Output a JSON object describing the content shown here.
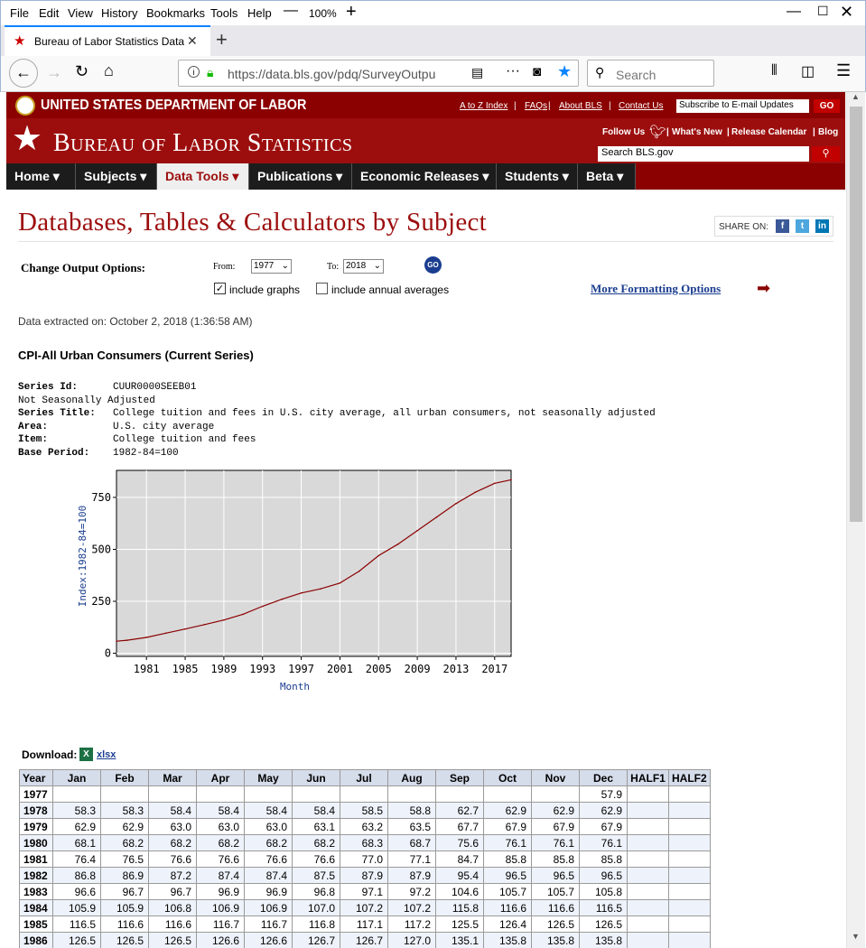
{
  "browser": {
    "menu": [
      "File",
      "Edit",
      "View",
      "History",
      "Bookmarks",
      "Tools",
      "Help"
    ],
    "zoom": "100%",
    "tab_title": "Bureau of Labor Statistics Data",
    "url": "https://data.bls.gov/pdq/SurveyOutpu",
    "search_placeholder": "Search"
  },
  "site": {
    "dept": "UNITED STATES DEPARTMENT OF LABOR",
    "top_links": [
      "A to Z Index",
      "FAQs",
      "About BLS",
      "Contact Us"
    ],
    "subscribe_value": "Subscribe to E-mail Updates",
    "go": "GO",
    "title": "Bureau of Labor Statistics",
    "follow": "Follow Us",
    "header_links": [
      "What's New",
      "Release Calendar",
      "Blog"
    ],
    "search_value": "Search BLS.gov",
    "nav": [
      {
        "label": "Home"
      },
      {
        "label": "Subjects"
      },
      {
        "label": "Data Tools"
      },
      {
        "label": "Publications"
      },
      {
        "label": "Economic Releases"
      },
      {
        "label": "Students"
      },
      {
        "label": "Beta"
      }
    ]
  },
  "page": {
    "heading": "Databases, Tables & Calculators by Subject",
    "share_on": "SHARE ON:",
    "change_output": "Change Output Options:",
    "from_label": "From:",
    "from_value": "1977",
    "to_label": "To:",
    "to_value": "2018",
    "go": "GO",
    "include_graphs": "include graphs",
    "include_annual": "include annual averages",
    "more_formatting": "More Formatting Options",
    "extracted": "Data extracted on: October 2, 2018 (1:36:58 AM)",
    "series_heading": "CPI-All Urban Consumers (Current Series)",
    "series": {
      "id_label": "Series Id:",
      "id": "CUUR0000SEEB01",
      "adj": "Not Seasonally Adjusted",
      "title_label": "Series Title:",
      "title": "College tuition and fees in U.S. city average, all urban consumers, not seasonally adjusted",
      "area_label": "Area:",
      "area": "U.S. city average",
      "item_label": "Item:",
      "item": "College tuition and fees",
      "base_label": "Base Period:",
      "base": "1982-84=100"
    },
    "download": "Download:",
    "xlsx": "xlsx"
  },
  "chart_data": {
    "type": "line",
    "xlabel": "Month",
    "ylabel": "Index:1982-84=100",
    "x_ticks": [
      "1981",
      "1985",
      "1989",
      "1993",
      "1997",
      "2001",
      "2005",
      "2009",
      "2013",
      "2017"
    ],
    "y_ticks": [
      0,
      250,
      500,
      750
    ],
    "ylim": [
      -15,
      880
    ],
    "xlim": [
      1977.9,
      2018.7
    ],
    "grid": true,
    "color": "#8b0000",
    "series": [
      {
        "x": [
          1977.9,
          1979,
          1981,
          1983,
          1985,
          1987,
          1989,
          1991,
          1993,
          1995,
          1997,
          1999,
          2001,
          2003,
          2005,
          2007,
          2009,
          2011,
          2013,
          2015,
          2017,
          2018.7
        ],
        "values": [
          57.9,
          62.9,
          76.4,
          96.6,
          116.5,
          138,
          160,
          188,
          226,
          260,
          290,
          310,
          338,
          395,
          470,
          525,
          590,
          655,
          720,
          775,
          818,
          835
        ]
      }
    ]
  },
  "table": {
    "headers": [
      "Year",
      "Jan",
      "Feb",
      "Mar",
      "Apr",
      "May",
      "Jun",
      "Jul",
      "Aug",
      "Sep",
      "Oct",
      "Nov",
      "Dec",
      "HALF1",
      "HALF2"
    ],
    "rows": [
      [
        "1977",
        "",
        "",
        "",
        "",
        "",
        "",
        "",
        "",
        "",
        "",
        "",
        "57.9",
        "",
        ""
      ],
      [
        "1978",
        "58.3",
        "58.3",
        "58.4",
        "58.4",
        "58.4",
        "58.4",
        "58.5",
        "58.8",
        "62.7",
        "62.9",
        "62.9",
        "62.9",
        "",
        ""
      ],
      [
        "1979",
        "62.9",
        "62.9",
        "63.0",
        "63.0",
        "63.0",
        "63.1",
        "63.2",
        "63.5",
        "67.7",
        "67.9",
        "67.9",
        "67.9",
        "",
        ""
      ],
      [
        "1980",
        "68.1",
        "68.2",
        "68.2",
        "68.2",
        "68.2",
        "68.2",
        "68.3",
        "68.7",
        "75.6",
        "76.1",
        "76.1",
        "76.1",
        "",
        ""
      ],
      [
        "1981",
        "76.4",
        "76.5",
        "76.6",
        "76.6",
        "76.6",
        "76.6",
        "77.0",
        "77.1",
        "84.7",
        "85.8",
        "85.8",
        "85.8",
        "",
        ""
      ],
      [
        "1982",
        "86.8",
        "86.9",
        "87.2",
        "87.4",
        "87.4",
        "87.5",
        "87.9",
        "87.9",
        "95.4",
        "96.5",
        "96.5",
        "96.5",
        "",
        ""
      ],
      [
        "1983",
        "96.6",
        "96.7",
        "96.7",
        "96.9",
        "96.9",
        "96.8",
        "97.1",
        "97.2",
        "104.6",
        "105.7",
        "105.7",
        "105.8",
        "",
        ""
      ],
      [
        "1984",
        "105.9",
        "105.9",
        "106.8",
        "106.9",
        "106.9",
        "107.0",
        "107.2",
        "107.2",
        "115.8",
        "116.6",
        "116.6",
        "116.5",
        "",
        ""
      ],
      [
        "1985",
        "116.5",
        "116.6",
        "116.6",
        "116.7",
        "116.7",
        "116.8",
        "117.1",
        "117.2",
        "125.5",
        "126.4",
        "126.5",
        "126.5",
        "",
        ""
      ],
      [
        "1986",
        "126.5",
        "126.5",
        "126.5",
        "126.6",
        "126.6",
        "126.7",
        "126.7",
        "127.0",
        "135.1",
        "135.8",
        "135.8",
        "135.8",
        "",
        ""
      ]
    ]
  }
}
